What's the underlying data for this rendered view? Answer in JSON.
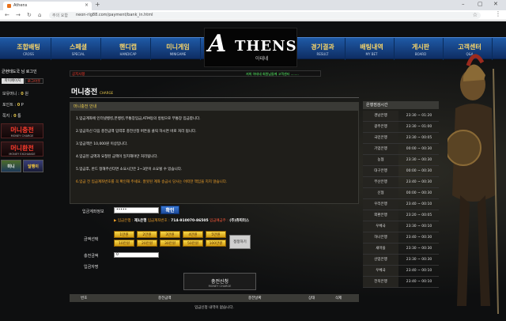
{
  "browser": {
    "tab_title": "Athens",
    "new_tab": "+",
    "url_info": "주의 요함",
    "url": "neon-rig88.com/payment/bank_in.html",
    "win_min": "–",
    "win_max": "▢",
    "win_close": "✕"
  },
  "nav": [
    {
      "ko": "조합배팅",
      "en": "CROSS"
    },
    {
      "ko": "스페셜",
      "en": "SPECIAL"
    },
    {
      "ko": "핸디캡",
      "en": "HANDICAP"
    },
    {
      "ko": "미니게임",
      "en": "MINIGAME"
    },
    {
      "ko": "경기결과",
      "en": "RESULT"
    },
    {
      "ko": "배팅내역",
      "en": "MY BET"
    },
    {
      "ko": "게시판",
      "en": "BOARD"
    },
    {
      "ko": "고객센터",
      "en": "Q&A"
    }
  ],
  "logo": {
    "big": "A",
    "rest": "THENS",
    "sub": "아테네"
  },
  "sidebar": {
    "welcome": "균현테도국 님 로그인",
    "mypage": "마이페이지",
    "logout": "로그아웃",
    "money_label": "보유머니",
    "money_value": "0",
    "money_unit": "원",
    "point_label": "포인트",
    "point_value": "0",
    "point_unit": "P",
    "note_label": "쪽지",
    "note_value": "0",
    "note_unit": "통",
    "deposit_ko": "머니충전",
    "deposit_en": "MONEY CHARGE",
    "withdraw_ko": "머니환전",
    "withdraw_en": "MONEY EXCHANGE",
    "thumb1": "미니",
    "thumb2": "달팽이"
  },
  "notice": {
    "label": "공지사항",
    "message": "저희 아테네 회원님들께 고객센터 ........"
  },
  "page_title": "머니충전",
  "page_title_en": "CHARGE",
  "info": {
    "header": "머니충전 안내",
    "lines": [
      "1.입금계좌에 인터넷뱅킹,폰뱅킹,무통장입금,ATM등의 방법으로 무통장 입금합니다.",
      "2.입금하신 다음 충전금액 입력후 충전신청 버튼을 클릭 하시면 바로 처리 됩니다.",
      "3.입금액은 10,000원 이상입니다.",
      "4.입금된 금액과 요청된 금액이 일치해야만 처리됩니다.",
      "5.입금후, 반드 정해주신다면 소요시간은 2~3분이 소요될 수 있습니다.",
      "6.입금 전 입금계좌번호를 꼭 확인해 주세요. 잘못된 계좌 송금시 당사는 어떠한 책임을 지지 않습니다."
    ]
  },
  "form": {
    "depositor_label": "입금계좌정보",
    "depositor_value": "•••••",
    "confirm_btn": "확인",
    "bank_prefix": "▶ 입금은행 :",
    "bank_name": "제1은행",
    "acct_prefix": "입금계좌번호 :",
    "acct_no": "714-910070-86505",
    "holder_prefix": "입금예금주 :",
    "holder": "(주)쥬피터스",
    "amount_select_label": "금액선택",
    "amounts": [
      "1만원",
      "2만원",
      "3만원",
      "4만원",
      "5만원",
      "10만원",
      "20만원",
      "30만원",
      "50만원",
      "100만원"
    ],
    "reset_btn": "정정하기",
    "amount_label": "충전금액",
    "amount_value": "0",
    "memo_label": "입금자명",
    "submit_ko": "충전신청",
    "submit_en": "MONEY CHARGE"
  },
  "history": {
    "headers": [
      "번호",
      "충전금액",
      "충전날짜",
      "상태",
      "삭제"
    ],
    "empty": "입금신청 내역이 없습니다."
  },
  "banks": {
    "header": "은행점검시간",
    "rows": [
      {
        "name": "경남은행",
        "time": "23:30 ~ 01:20"
      },
      {
        "name": "광주은행",
        "time": "23:30 ~ 01:00"
      },
      {
        "name": "국민은행",
        "time": "23:30 ~ 00:05"
      },
      {
        "name": "기업은행",
        "time": "00:00 ~ 00:30"
      },
      {
        "name": "농협",
        "time": "23:30 ~ 00:30"
      },
      {
        "name": "대구은행",
        "time": "00:00 ~ 00:30"
      },
      {
        "name": "부산은행",
        "time": "23:40 ~ 00:30"
      },
      {
        "name": "신협",
        "time": "00:00 ~ 00:30"
      },
      {
        "name": "우리은행",
        "time": "23:40 ~ 00:10"
      },
      {
        "name": "외환은행",
        "time": "23:20 ~ 00:05"
      },
      {
        "name": "우체국",
        "time": "23:30 ~ 00:10"
      },
      {
        "name": "하나은행",
        "time": "23:40 ~ 00:30"
      },
      {
        "name": "새마을",
        "time": "23:30 ~ 00:30"
      },
      {
        "name": "산업은행",
        "time": "23:30 ~ 00:30"
      },
      {
        "name": "우체국",
        "time": "23:40 ~ 00:10"
      },
      {
        "name": "전북은행",
        "time": "23:40 ~ 00:10"
      }
    ]
  }
}
